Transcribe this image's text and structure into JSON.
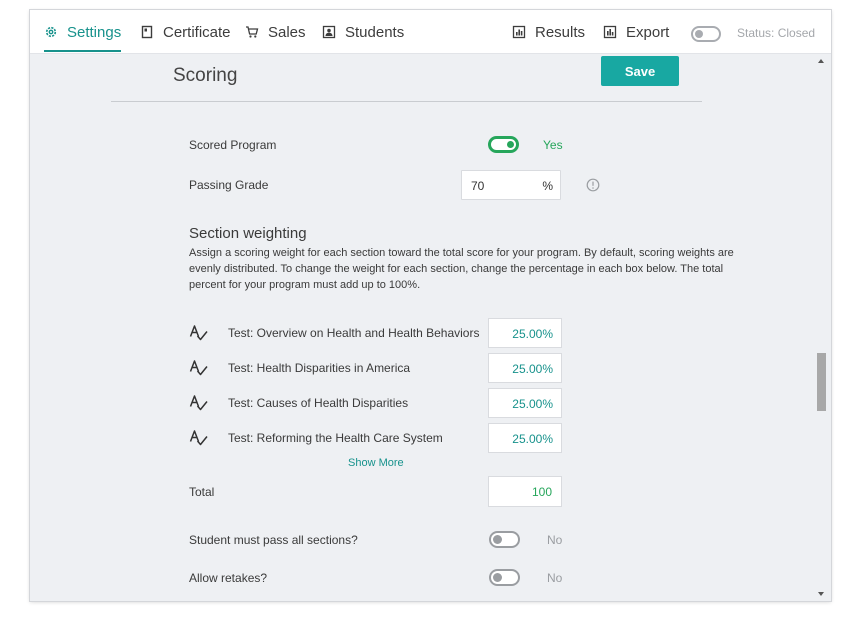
{
  "nav": {
    "settings": "Settings",
    "certificate": "Certificate",
    "sales": "Sales",
    "students": "Students",
    "results": "Results",
    "export": "Export",
    "status": "Status: Closed"
  },
  "colors": {
    "accent": "#17928c",
    "save_button": "#18a8a2",
    "toggle_on": "#26a65b",
    "toggle_off": "#9a9da1"
  },
  "scoring": {
    "title": "Scoring",
    "save_label": "Save",
    "scored_program_label": "Scored Program",
    "scored_program_on": true,
    "scored_program_value": "Yes",
    "passing_grade_label": "Passing Grade",
    "passing_grade_value": "70",
    "passing_grade_unit": "%"
  },
  "weighting": {
    "title": "Section weighting",
    "description": "Assign a scoring weight for each section toward the total score for your program. By default, scoring weights are evenly distributed. To change the weight for each section, change the percentage in each box below. The total percent for your program must add up to 100%.",
    "sections": [
      {
        "name": "Test: Overview on Health and Health Behaviors",
        "weight": "25.00%"
      },
      {
        "name": "Test: Health Disparities in America",
        "weight": "25.00%"
      },
      {
        "name": "Test: Causes of Health Disparities",
        "weight": "25.00%"
      },
      {
        "name": "Test: Reforming the Health Care System",
        "weight": "25.00%"
      }
    ],
    "show_more": "Show More",
    "total_label": "Total",
    "total_value": "100"
  },
  "options": {
    "must_pass_label": "Student must pass all sections?",
    "must_pass_on": false,
    "must_pass_value": "No",
    "retakes_label": "Allow retakes?",
    "retakes_on": false,
    "retakes_value": "No"
  },
  "icons": {
    "settings": "gear-icon",
    "certificate": "certificate-icon",
    "sales": "cart-icon",
    "students": "students-icon",
    "results": "results-chart-icon",
    "export": "export-chart-icon",
    "info": "info-icon",
    "test": "test-icon"
  }
}
